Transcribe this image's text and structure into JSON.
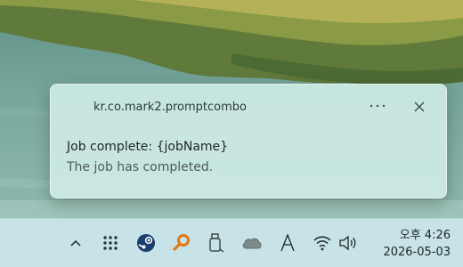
{
  "notification": {
    "app_name": "kr.co.mark2.promptcombo",
    "more_icon": "more-ellipsis-icon",
    "close_icon": "close-icon",
    "title": "Job complete: {jobName}",
    "body": "The job has completed."
  },
  "taskbar": {
    "tray_icons": [
      "chevron-up-icon",
      "app-grid-icon",
      "steam-icon",
      "search-key-icon",
      "usb-drive-icon",
      "cloud-icon",
      "font-a-icon",
      "wifi-icon",
      "speaker-icon"
    ],
    "clock": {
      "time": "오후 4:26",
      "date": "2026-05-03"
    }
  },
  "colors": {
    "toast_background": "#cdeae4",
    "taskbar_background": "#c7e3e7",
    "steam_blue": "#1b3f6b",
    "search_orange": "#e07a10"
  }
}
